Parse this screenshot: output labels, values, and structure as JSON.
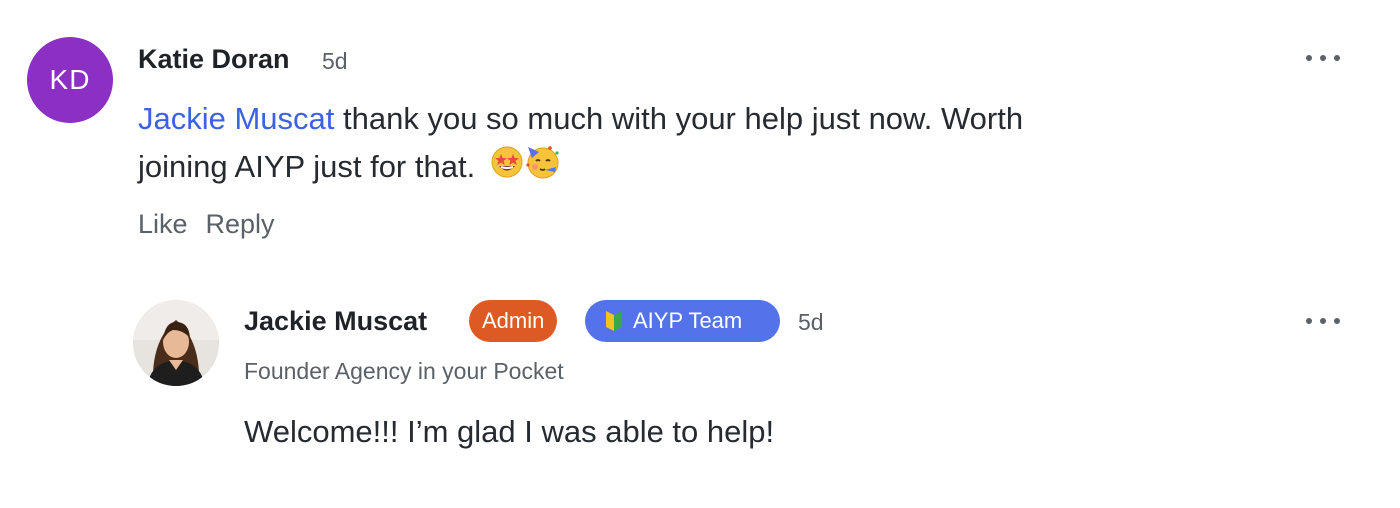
{
  "comments": [
    {
      "author": "Katie Doran",
      "initials": "KD",
      "avatar_color": "#8c2fc3",
      "time": "5d",
      "mention": "Jackie Muscat",
      "text_line1": " thank you so much with your help just now. Worth",
      "text_line2": "joining AIYP just for that.",
      "emojis": [
        "star-struck-emoji",
        "partying-face-emoji"
      ],
      "actions": {
        "like": "Like",
        "reply": "Reply"
      },
      "more_icon": "ellipsis-icon"
    }
  ],
  "reply": {
    "author": "Jackie Muscat",
    "badges": [
      {
        "label": "Admin",
        "color": "#de5a24"
      },
      {
        "label": "AIYP Team",
        "color": "#5473ea",
        "icon": "beginner-shield-icon"
      }
    ],
    "time": "5d",
    "subtitle": "Founder Agency in your Pocket",
    "text": "Welcome!!! I’m glad I was able to help!",
    "more_icon": "ellipsis-icon"
  },
  "colors": {
    "mention": "#3c62e3",
    "muted_text": "#5b6168",
    "body_text": "#262b31"
  }
}
